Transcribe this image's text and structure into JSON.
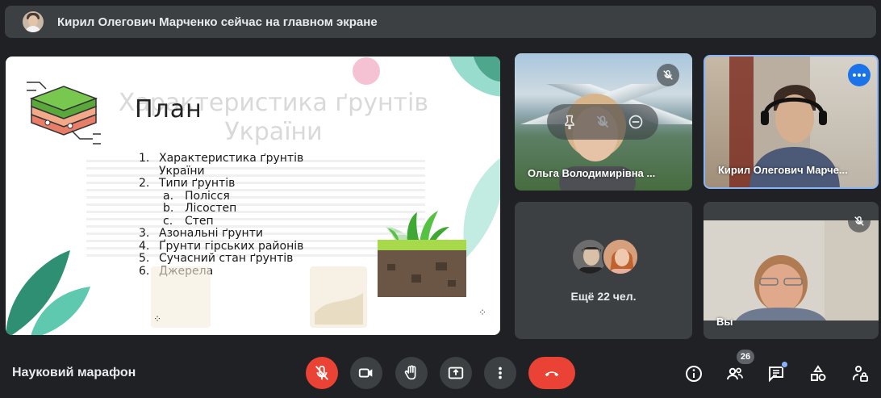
{
  "banner": {
    "text": "Кирил Олегович Марченко сейчас на главном экране"
  },
  "presentation": {
    "watermark_title_line1": "Характеристика ґрунтів",
    "watermark_title_line2": "України",
    "title": "План",
    "items": [
      {
        "num": "1.",
        "text": "Характеристика ґрунтів"
      },
      {
        "num": "",
        "text": "України"
      },
      {
        "num": "2.",
        "text": "Типи ґрунтів"
      },
      {
        "num": "a.",
        "text": "Полісся",
        "sub": true
      },
      {
        "num": "b.",
        "text": "Лісостеп",
        "sub": true
      },
      {
        "num": "c.",
        "text": "Степ",
        "sub": true
      },
      {
        "num": "3.",
        "text": "Азональні ґрунти"
      },
      {
        "num": "4.",
        "text": "Ґрунти гірських районів"
      },
      {
        "num": "5.",
        "text": "Сучасний стан ґрунтів"
      },
      {
        "num": "6.",
        "text": "Джерела"
      }
    ]
  },
  "participants": {
    "tile1": {
      "name": "Ольга Володимирівна ...",
      "muted": true
    },
    "tile2": {
      "name": "Кирил Олегович Марче...",
      "active_speaker": true
    },
    "tile3": {
      "more_text": "Ещё 22 чел."
    },
    "tile4": {
      "name": "Вы",
      "muted": true
    }
  },
  "controls": {
    "meeting_name": "Науковий марафон",
    "participants_count": "26"
  },
  "colors": {
    "background": "#202124",
    "tile": "#3c4043",
    "danger": "#ea4335",
    "accent": "#8ab4f8",
    "active_button": "#1a73e8"
  }
}
